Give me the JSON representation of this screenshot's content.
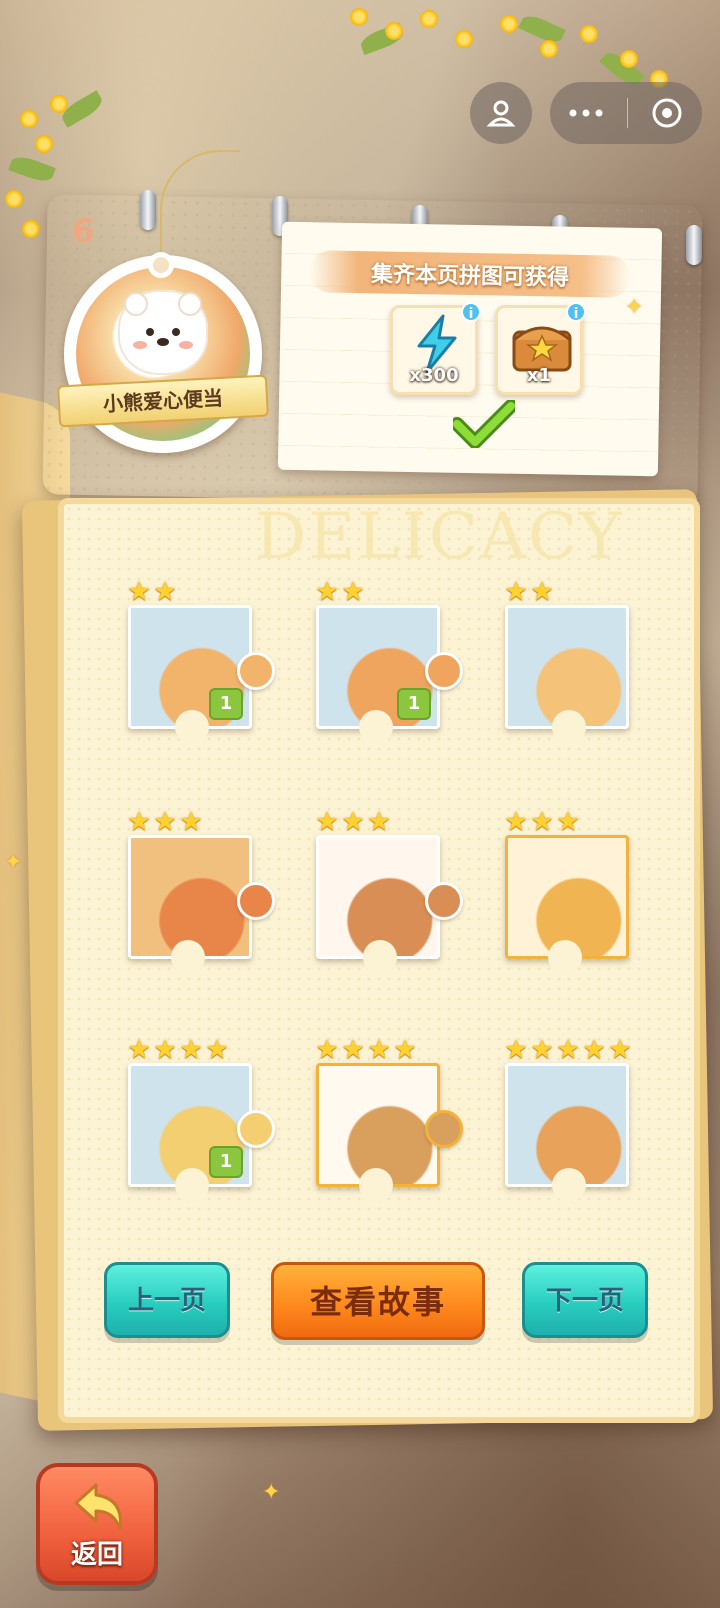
{
  "page": {
    "number": "6",
    "watermark": "DELICACY"
  },
  "badge": {
    "title": "小熊爱心便当"
  },
  "reward_note": {
    "title": "集齐本页拼图可获得",
    "items": [
      {
        "name": "energy",
        "icon": "lightning-icon",
        "quantity": "x300",
        "info": "i"
      },
      {
        "name": "chest",
        "icon": "treasure-chest-icon",
        "quantity": "x1",
        "info": "i"
      }
    ],
    "claimed": true
  },
  "puzzle": {
    "pieces": [
      {
        "stars": 2,
        "count": "1",
        "colors": [
          "#cfe3ec",
          "#f2b36b"
        ]
      },
      {
        "stars": 2,
        "count": "1",
        "colors": [
          "#cfe3ec",
          "#f0a55f"
        ]
      },
      {
        "stars": 2,
        "count": "",
        "colors": [
          "#cfe3ec",
          "#f5c27a"
        ]
      },
      {
        "stars": 3,
        "count": "",
        "colors": [
          "#f2c07e",
          "#e8864a"
        ]
      },
      {
        "stars": 3,
        "count": "",
        "colors": [
          "#fff7ee",
          "#d98e55"
        ]
      },
      {
        "stars": 3,
        "count": "",
        "colors": [
          "#fff2d6",
          "#f0b453"
        ],
        "selected": true
      },
      {
        "stars": 4,
        "count": "1",
        "colors": [
          "#cfe3ec",
          "#f3cf72"
        ]
      },
      {
        "stars": 4,
        "count": "",
        "colors": [
          "#fff9f0",
          "#d9a05d"
        ],
        "selected": true
      },
      {
        "stars": 5,
        "count": "",
        "colors": [
          "#cfe3ec",
          "#e8a259"
        ]
      }
    ]
  },
  "buttons": {
    "prev": "上一页",
    "story": "查看故事",
    "next": "下一页",
    "back": "返回"
  },
  "colors": {
    "teal": "#29cdbf",
    "orange": "#ff8a1e",
    "back_red": "#f0613e",
    "star": "#ffd22e",
    "count_green": "#8cc63f"
  }
}
